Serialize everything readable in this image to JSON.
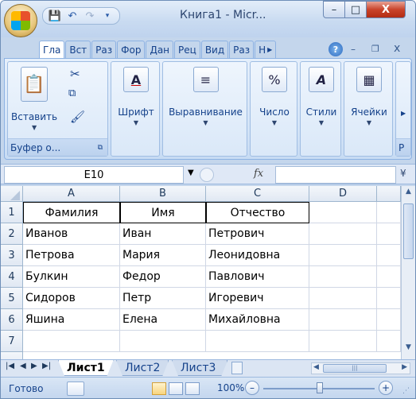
{
  "window": {
    "title": "Книга1 - Micr...",
    "minimize_glyph": "–",
    "maximize_glyph": "□",
    "close_glyph": "X"
  },
  "quick_access": [
    "save-icon",
    "undo-icon",
    "redo-icon",
    "customize-icon"
  ],
  "ribbon_tabs": [
    "Гла",
    "Вст",
    "Раз",
    "Фор",
    "Дан",
    "Рец",
    "Вид",
    "Раз",
    "Н"
  ],
  "ribbon": {
    "clipboard": {
      "paste_label": "Вставить",
      "group_label": "Буфер о..."
    },
    "font": {
      "label": "Шрифт",
      "icon_glyph": "A"
    },
    "alignment": {
      "label": "Выравнивание",
      "icon_glyph": "≡"
    },
    "number": {
      "label": "Число",
      "icon_glyph": "%"
    },
    "styles": {
      "label": "Стили",
      "icon_glyph": "A"
    },
    "cells": {
      "label": "Ячейки",
      "icon_glyph": "▦"
    },
    "editing_partial": "Р"
  },
  "formula_bar": {
    "name_box": "E10",
    "fx_label": "fx",
    "formula": ""
  },
  "sheet": {
    "column_headers": [
      "A",
      "B",
      "C",
      "D"
    ],
    "row_headers": [
      "1",
      "2",
      "3",
      "4",
      "5",
      "6",
      "7"
    ],
    "rows": [
      [
        "Фамилия",
        "Имя",
        "Отчество",
        ""
      ],
      [
        "Иванов",
        "Иван",
        "Петрович",
        ""
      ],
      [
        "Петрова",
        "Мария",
        "Леонидовна",
        ""
      ],
      [
        "Булкин",
        "Федор",
        "Павлович",
        ""
      ],
      [
        "Сидоров",
        "Петр",
        "Игоревич",
        ""
      ],
      [
        "Яшина",
        "Елена",
        "Михайловна",
        ""
      ],
      [
        "",
        "",
        "",
        ""
      ]
    ]
  },
  "sheet_tabs": {
    "tabs": [
      "Лист1",
      "Лист2",
      "Лист3"
    ],
    "active": "Лист1"
  },
  "status_bar": {
    "status": "Готово",
    "zoom": "100%",
    "zoom_out": "–",
    "zoom_in": "+"
  }
}
